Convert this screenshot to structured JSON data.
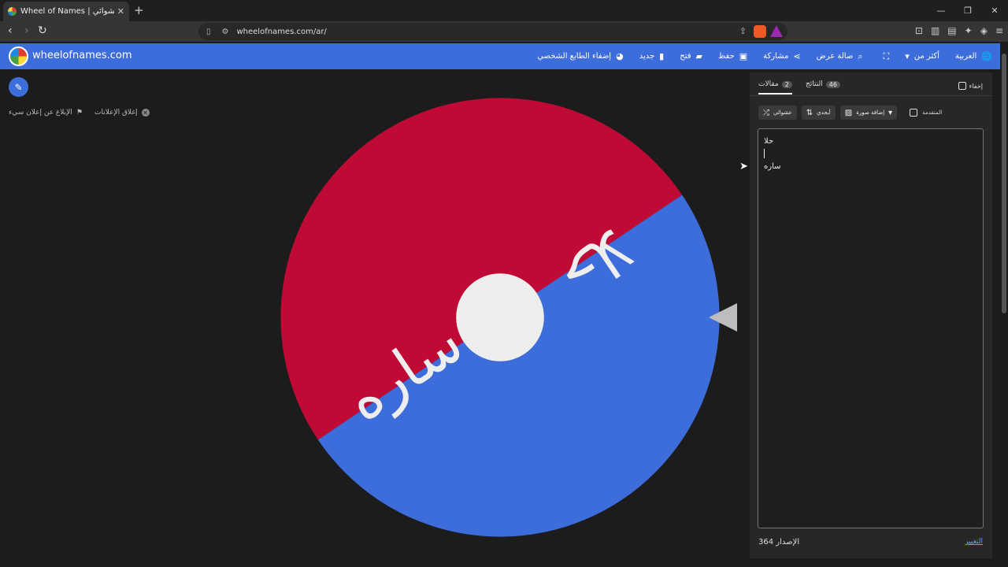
{
  "browser": {
    "tab_title": "Wheel of Names | الاسم العشوائي",
    "tab_close": "✕",
    "new_tab": "+",
    "url": "wheelofnames.com/ar/",
    "win_min": "—",
    "win_restore": "❐",
    "win_close": "✕"
  },
  "header": {
    "site_name": "wheelofnames.com",
    "menu": [
      {
        "label": "العربية",
        "icon": "globe-icon",
        "glyph": "🌐"
      },
      {
        "label": "أكثر من",
        "icon": "chevron-down-icon",
        "glyph": "▾"
      },
      {
        "label": "",
        "icon": "fullscreen-icon",
        "glyph": "⛶"
      },
      {
        "label": "صالة عرض",
        "icon": "search-icon",
        "glyph": "⌕"
      },
      {
        "label": "مشاركة",
        "icon": "share-icon",
        "glyph": "⋖"
      },
      {
        "label": "حفظ",
        "icon": "save-icon",
        "glyph": "▣"
      },
      {
        "label": "فتح",
        "icon": "folder-icon",
        "glyph": "▰"
      },
      {
        "label": "جديد",
        "icon": "file-icon",
        "glyph": "▮"
      },
      {
        "label": "إضفاء الطابع الشخصي",
        "icon": "palette-icon",
        "glyph": "◕"
      }
    ]
  },
  "left": {
    "close_ads": "إغلاق الإعلانات",
    "report_ad": "الإبلاغ عن إعلان سيء"
  },
  "wheel": {
    "segments": [
      {
        "label": "ساره",
        "color": "#be0a34"
      },
      {
        "label": "حلا",
        "color": "#3d6ddb"
      }
    ]
  },
  "panel": {
    "hide_label": "إخفاء",
    "tab_entries": {
      "label": "مقالات",
      "count": "2"
    },
    "tab_results": {
      "label": "النتائج",
      "count": "46"
    },
    "shuffle": "عشوائي",
    "sort": "أبجدي",
    "add_image": "إضافة صورة",
    "advanced": "المتقدمة",
    "entries": [
      "حلا",
      "",
      "ساره"
    ],
    "version_label": "الإصدار",
    "version": "364",
    "changelog": "التغيير"
  }
}
